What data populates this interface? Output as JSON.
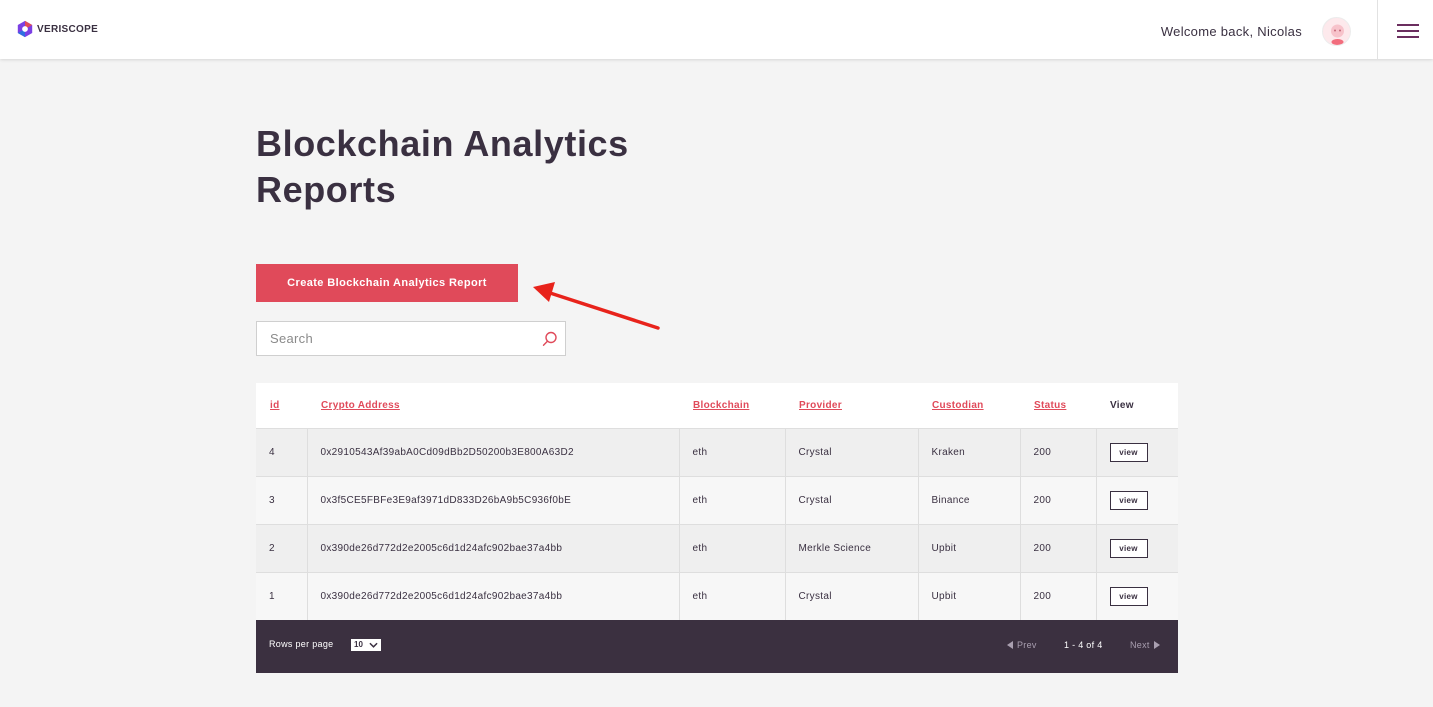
{
  "header": {
    "brand": "VERISCOPE",
    "welcome": "Welcome back, Nicolas"
  },
  "page": {
    "title": "Blockchain Analytics Reports",
    "create_button": "Create Blockchain Analytics Report"
  },
  "search": {
    "placeholder": "Search",
    "value": ""
  },
  "table": {
    "columns": [
      "id",
      "Crypto Address",
      "Blockchain",
      "Provider",
      "Custodian",
      "Status",
      "View"
    ],
    "rows": [
      {
        "id": "4",
        "address": "0x2910543Af39abA0Cd09dBb2D50200b3E800A63D2",
        "blockchain": "eth",
        "provider": "Crystal",
        "custodian": "Kraken",
        "status": "200",
        "view": "view"
      },
      {
        "id": "3",
        "address": "0x3f5CE5FBFe3E9af3971dD833D26bA9b5C936f0bE",
        "blockchain": "eth",
        "provider": "Crystal",
        "custodian": "Binance",
        "status": "200",
        "view": "view"
      },
      {
        "id": "2",
        "address": "0x390de26d772d2e2005c6d1d24afc902bae37a4bb",
        "blockchain": "eth",
        "provider": "Merkle Science",
        "custodian": "Upbit",
        "status": "200",
        "view": "view"
      },
      {
        "id": "1",
        "address": "0x390de26d772d2e2005c6d1d24afc902bae37a4bb",
        "blockchain": "eth",
        "provider": "Crystal",
        "custodian": "Upbit",
        "status": "200",
        "view": "view"
      }
    ]
  },
  "pagination": {
    "rows_per_page_label": "Rows per page",
    "rows_per_page": "10",
    "prev": "Prev",
    "range": "1 - 4 of 4",
    "next": "Next"
  },
  "colors": {
    "accent": "#e04a5a",
    "dark": "#3a3041",
    "footer": "#3b3040",
    "menu": "#6b2e5f",
    "annotation": "#e8231b"
  },
  "icons": {
    "logo": "veriscope-logo-icon",
    "search": "search-icon",
    "menu": "hamburger-menu-icon",
    "avatar": "user-avatar-icon"
  }
}
